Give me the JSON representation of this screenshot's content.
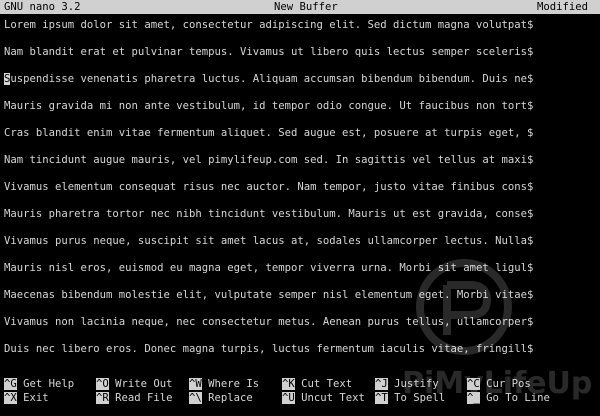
{
  "titlebar": {
    "app": "GNU nano 3.2",
    "buffer": "New Buffer",
    "status": "Modified"
  },
  "editor": {
    "cursor_char": "S",
    "lines": [
      "Lorem ipsum dolor sit amet, consectetur adipiscing elit. Sed dictum magna volutpat$",
      "Nam blandit erat et pulvinar tempus. Vivamus ut libero quis lectus semper sceleris$",
      "uspendisse venenatis pharetra luctus. Aliquam accumsan bibendum bibendum. Duis ne$",
      "Mauris gravida mi non ante vestibulum, id tempor odio congue. Ut faucibus non tort$",
      "Cras blandit enim vitae fermentum aliquet. Sed augue est, posuere at turpis eget, $",
      "Nam tincidunt augue mauris, vel pimylifeup.com sed. In sagittis vel tellus at maxi$",
      "Vivamus elementum consequat risus nec auctor. Nam tempor, justo vitae finibus cons$",
      "Mauris pharetra tortor nec nibh tincidunt vestibulum. Mauris ut est gravida, conse$",
      "Vivamus purus neque, suscipit sit amet lacus at, sodales ullamcorper lectus. Nulla$",
      "Mauris nisl eros, euismod eu magna eget, tempor viverra urna. Morbi sit amet ligul$",
      "Maecenas bibendum molestie elit, vulputate semper nisl elementum eget. Morbi vitae$",
      "Vivamus non lacinia neque, nec consectetur metus. Aenean purus tellus, ullamcorper$",
      "Duis nec libero eros. Donec magna turpis, luctus fermentum iaculis vitae, fringill$"
    ]
  },
  "shortcuts": {
    "row1": [
      {
        "key": "^G",
        "label": " Get Help"
      },
      {
        "key": "^O",
        "label": " Write Out"
      },
      {
        "key": "^W",
        "label": " Where Is"
      },
      {
        "key": "^K",
        "label": " Cut Text"
      },
      {
        "key": "^J",
        "label": " Justify"
      },
      {
        "key": "^C",
        "label": " Cur Pos"
      }
    ],
    "row2": [
      {
        "key": "^X",
        "label": " Exit"
      },
      {
        "key": "^R",
        "label": " Read File"
      },
      {
        "key": "^\\",
        "label": " Replace"
      },
      {
        "key": "^U",
        "label": " Uncut Text"
      },
      {
        "key": "^T",
        "label": " To Spell"
      },
      {
        "key": "^_",
        "label": " Go To Line"
      }
    ]
  },
  "watermark": {
    "text": "PiMyLifeUp"
  }
}
